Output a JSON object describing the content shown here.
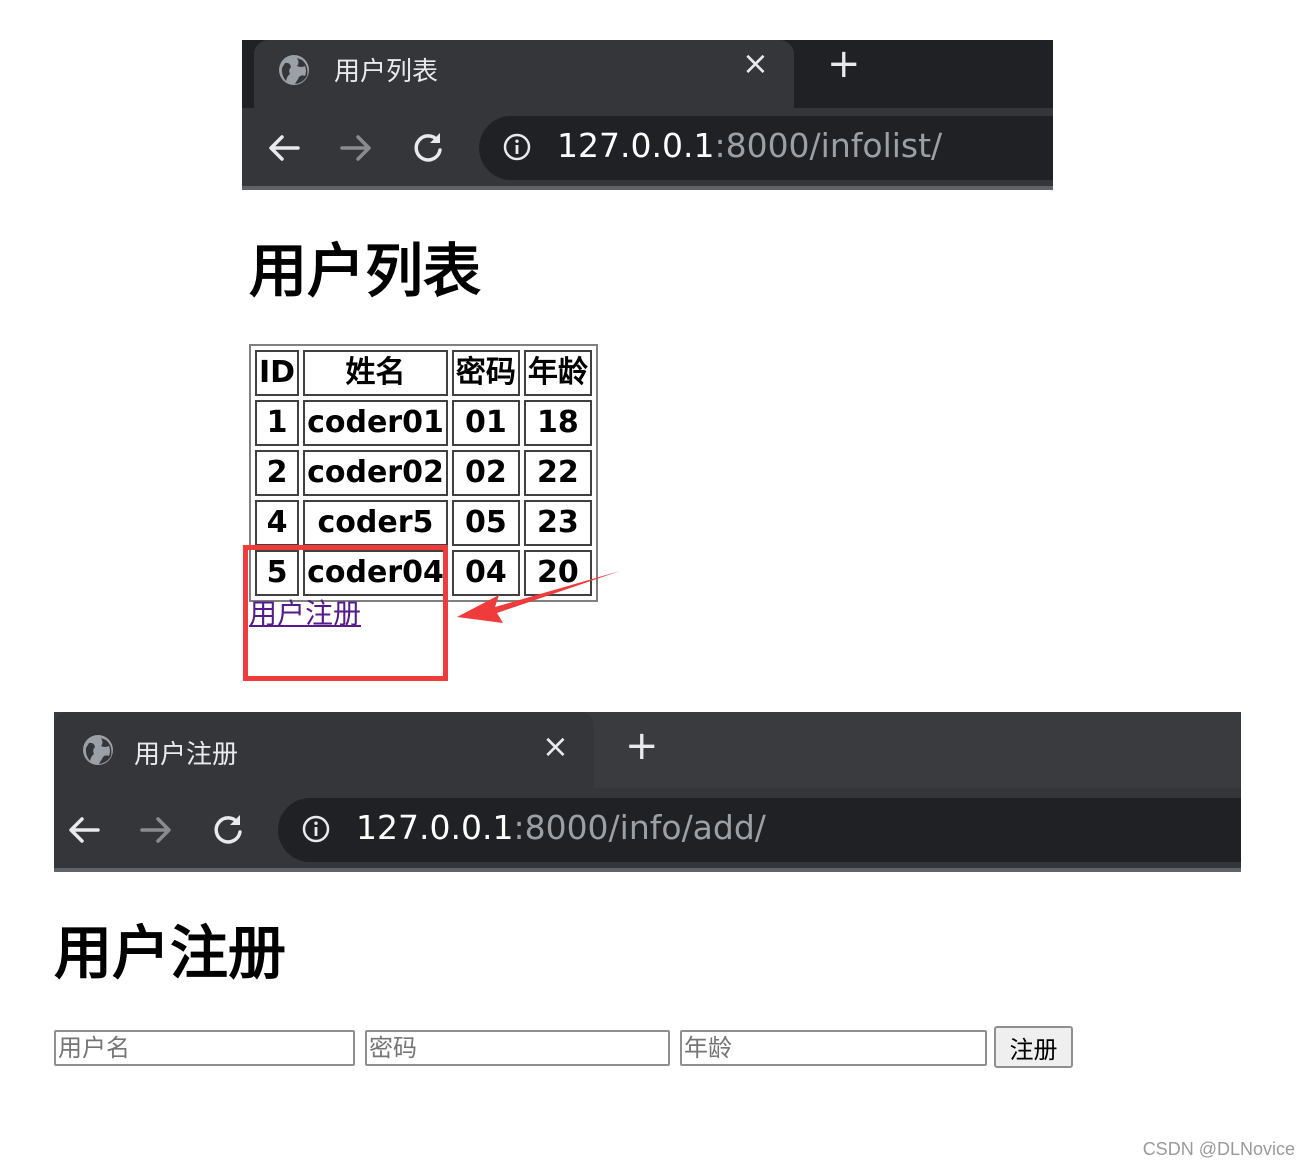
{
  "browser1": {
    "tab_title": "用户列表",
    "close_glyph": "×",
    "newtab_glyph": "+",
    "url_host": "127.0.0.1",
    "url_rest": ":8000/infolist/"
  },
  "page1": {
    "heading": "用户列表",
    "table": {
      "headers": [
        "ID",
        "姓名",
        "密码",
        "年龄"
      ],
      "rows": [
        [
          "1",
          "coder01",
          "01",
          "18"
        ],
        [
          "2",
          "coder02",
          "02",
          "22"
        ],
        [
          "4",
          "coder5",
          "05",
          "23"
        ],
        [
          "5",
          "coder04",
          "04",
          "20"
        ]
      ]
    },
    "register_link": "用户注册",
    "annotation_color": "#ef3b3b"
  },
  "browser2": {
    "tab_title": "用户注册",
    "close_glyph": "×",
    "newtab_glyph": "+",
    "url_host": "127.0.0.1",
    "url_rest": ":8000/info/add/"
  },
  "page2": {
    "heading": "用户注册",
    "form": {
      "username_placeholder": "用户名",
      "password_placeholder": "密码",
      "age_placeholder": "年龄",
      "submit_label": "注册"
    }
  },
  "watermark": "CSDN @DLNovice",
  "icons": {
    "back": "back-arrow-icon",
    "forward": "forward-arrow-icon",
    "reload": "reload-icon",
    "info": "info-icon",
    "globe": "globe-icon"
  }
}
